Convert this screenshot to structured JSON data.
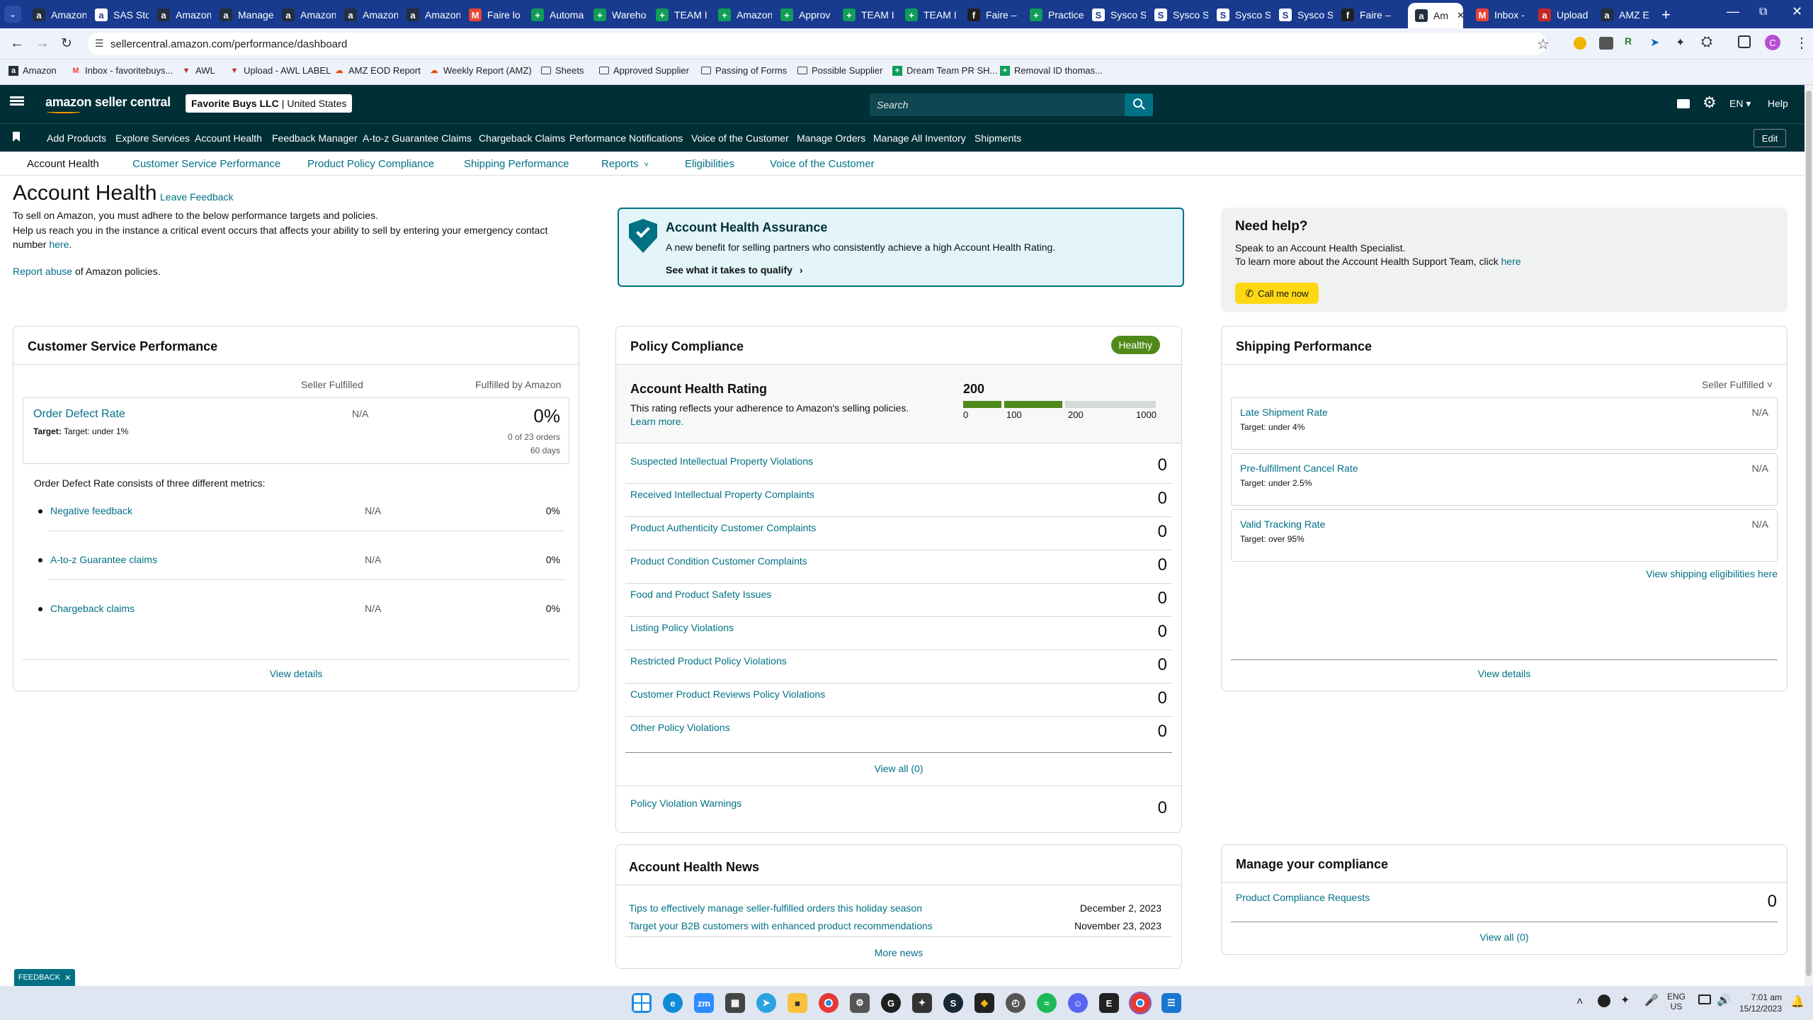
{
  "browser": {
    "tabs": [
      {
        "label": "Amazon",
        "icon": "amazon-favicon",
        "color": "#232f3e"
      },
      {
        "label": "SAS Sto",
        "icon": "sas-favicon",
        "color": "#ffffff"
      },
      {
        "label": "Amazon",
        "icon": "amazon-favicon",
        "color": "#232f3e"
      },
      {
        "label": "Manage",
        "icon": "amazon-favicon",
        "color": "#232f3e"
      },
      {
        "label": "Amazon",
        "icon": "amazon-favicon",
        "color": "#232f3e"
      },
      {
        "label": "Amazon",
        "icon": "amazon-favicon",
        "color": "#232f3e"
      },
      {
        "label": "Amazon",
        "icon": "amazon-favicon",
        "color": "#232f3e"
      },
      {
        "label": "Faire lo",
        "icon": "gmail-favicon",
        "color": "#ea4335"
      },
      {
        "label": "Automa",
        "icon": "sheets-favicon",
        "color": "#0f9d58"
      },
      {
        "label": "Wareho",
        "icon": "sheets-favicon",
        "color": "#0f9d58"
      },
      {
        "label": "TEAM I",
        "icon": "sheets-favicon",
        "color": "#0f9d58"
      },
      {
        "label": "Amazon",
        "icon": "sheets-favicon",
        "color": "#0f9d58"
      },
      {
        "label": "Approv",
        "icon": "sheets-favicon",
        "color": "#0f9d58"
      },
      {
        "label": "TEAM I",
        "icon": "sheets-favicon",
        "color": "#0f9d58"
      },
      {
        "label": "TEAM I",
        "icon": "sheets-favicon",
        "color": "#0f9d58"
      },
      {
        "label": "Faire –",
        "icon": "faire-favicon",
        "color": "#1f1f1f"
      },
      {
        "label": "Practice",
        "icon": "sheets-favicon",
        "color": "#0f9d58"
      },
      {
        "label": "Sysco S",
        "icon": "sysco-favicon",
        "color": "#ffffff"
      },
      {
        "label": "Sysco S",
        "icon": "sysco-favicon",
        "color": "#ffffff"
      },
      {
        "label": "Sysco S",
        "icon": "sysco-favicon",
        "color": "#ffffff"
      },
      {
        "label": "Sysco S",
        "icon": "sysco-favicon",
        "color": "#ffffff"
      },
      {
        "label": "Faire –",
        "icon": "faire-favicon",
        "color": "#1f1f1f"
      },
      {
        "label": "Am",
        "icon": "amazon-favicon",
        "color": "#232f3e",
        "active": true
      },
      {
        "label": "Inbox -",
        "icon": "gmail-favicon",
        "color": "#ea4335"
      },
      {
        "label": "Upload",
        "icon": "awl-favicon",
        "color": "#c62828"
      },
      {
        "label": "AMZ E",
        "icon": "amz-favicon",
        "color": "#232f3e"
      }
    ],
    "url": "sellercentral.amazon.com/performance/dashboard",
    "bookmarks": [
      {
        "label": "Amazon",
        "icon": "amazon-favicon"
      },
      {
        "label": "Inbox - favoritebuys...",
        "icon": "gmail-favicon"
      },
      {
        "label": "AWL",
        "icon": "awl-favicon"
      },
      {
        "label": "Upload - AWL LABEL",
        "icon": "awl-favicon"
      },
      {
        "label": "AMZ EOD Report",
        "icon": "report-favicon"
      },
      {
        "label": "Weekly Report (AMZ)",
        "icon": "report-favicon"
      },
      {
        "label": "Sheets",
        "icon": "folder-icon"
      },
      {
        "label": "Approved Supplier",
        "icon": "folder-icon"
      },
      {
        "label": "Passing of Forms",
        "icon": "folder-icon"
      },
      {
        "label": "Possible Supplier",
        "icon": "folder-icon"
      },
      {
        "label": "Dream Team PR SH...",
        "icon": "sheets-favicon"
      },
      {
        "label": "Removal ID thomas...",
        "icon": "sheets-favicon"
      }
    ]
  },
  "header": {
    "logo_text": "amazon seller central",
    "account": "Favorite Buys LLC",
    "marketplace": "United States",
    "search_placeholder": "Search",
    "language": "EN",
    "help": "Help",
    "edit": "Edit",
    "nav": [
      "Add Products",
      "Explore Services",
      "Account Health",
      "Feedback Manager",
      "A-to-z Guarantee Claims",
      "Chargeback Claims",
      "Performance Notifications",
      "Voice of the Customer",
      "Manage Orders",
      "Manage All Inventory",
      "Shipments"
    ],
    "subnav": [
      "Account Health",
      "Customer Service Performance",
      "Product Policy Compliance",
      "Shipping Performance",
      "Reports",
      "Eligibilities",
      "Voice of the Customer"
    ]
  },
  "intro": {
    "title": "Account Health",
    "leave_feedback": "Leave Feedback",
    "line1": "To sell on Amazon, you must adhere to the below performance targets and policies.",
    "line2": "Help us reach you in the instance a critical event occurs that affects your ability to sell by entering your emergency contact number",
    "here": "here",
    "report_abuse": "Report abuse",
    "report_suffix": "of Amazon policies."
  },
  "assurance": {
    "title": "Account Health Assurance",
    "desc": "A new benefit for selling partners who consistently achieve a high Account Health Rating.",
    "link": "See what it takes to qualify"
  },
  "help_box": {
    "title": "Need help?",
    "line1": "Speak to an Account Health Specialist.",
    "line2": "To learn more about the Account Health Support Team, click",
    "here": "here",
    "button": "Call me now"
  },
  "csp": {
    "title": "Customer Service Performance",
    "col1": "Seller Fulfilled",
    "col2": "Fulfilled by Amazon",
    "odr_label": "Order Defect Rate",
    "odr_target": "Target: under 1%",
    "odr_sf": "N/A",
    "odr_fba": "0%",
    "odr_orders": "0 of 23 orders",
    "odr_days": "60 days",
    "consists": "Order Defect Rate consists of three different metrics:",
    "metrics": [
      {
        "label": "Negative feedback",
        "sf": "N/A",
        "fba": "0%"
      },
      {
        "label": "A-to-z Guarantee claims",
        "sf": "N/A",
        "fba": "0%"
      },
      {
        "label": "Chargeback claims",
        "sf": "N/A",
        "fba": "0%"
      }
    ],
    "view_details": "View details"
  },
  "policy": {
    "title": "Policy Compliance",
    "badge": "Healthy",
    "ahr_title": "Account Health Rating",
    "ahr_desc": "This rating reflects your adherence to Amazon's selling policies.",
    "learn_more": "Learn more.",
    "rating": "200",
    "rating_value": 200,
    "scale": [
      "0",
      "100",
      "200",
      "1000"
    ],
    "items": [
      {
        "label": "Suspected Intellectual Property Violations",
        "count": "0"
      },
      {
        "label": "Received Intellectual Property Complaints",
        "count": "0"
      },
      {
        "label": "Product Authenticity Customer Complaints",
        "count": "0"
      },
      {
        "label": "Product Condition Customer Complaints",
        "count": "0"
      },
      {
        "label": "Food and Product Safety Issues",
        "count": "0"
      },
      {
        "label": "Listing Policy Violations",
        "count": "0"
      },
      {
        "label": "Restricted Product Policy Violations",
        "count": "0"
      },
      {
        "label": "Customer Product Reviews Policy Violations",
        "count": "0"
      },
      {
        "label": "Other Policy Violations",
        "count": "0"
      }
    ],
    "view_all": "View all (0)",
    "warnings_label": "Policy Violation Warnings",
    "warnings_count": "0"
  },
  "shipping": {
    "title": "Shipping Performance",
    "filter": "Seller Fulfilled",
    "items": [
      {
        "label": "Late Shipment Rate",
        "target": "Target: under 4%",
        "value": "N/A"
      },
      {
        "label": "Pre-fulfillment Cancel Rate",
        "target": "Target: under 2.5%",
        "value": "N/A"
      },
      {
        "label": "Valid Tracking Rate",
        "target": "Target: over 95%",
        "value": "N/A"
      }
    ],
    "eligibilities": "View shipping eligibilities here",
    "view_details": "View details"
  },
  "news": {
    "title": "Account Health News",
    "items": [
      {
        "label": "Tips to effectively manage seller-fulfilled orders this holiday season",
        "date": "December 2, 2023"
      },
      {
        "label": "Target your B2B customers with enhanced product recommendations",
        "date": "November 23, 2023"
      }
    ],
    "more": "More news"
  },
  "compliance": {
    "title": "Manage your compliance",
    "item": "Product Compliance Requests",
    "count": "0",
    "view_all": "View all (0)"
  },
  "feedback_tab": "FEEDBACK",
  "taskbar": {
    "lang1": "ENG",
    "lang2": "US",
    "time": "7:01 am",
    "date": "15/12/2023"
  },
  "colors": {
    "header": "#002f36",
    "link": "#007185",
    "healthy": "#508a1b",
    "assurance_bg": "#e3f5f8",
    "assurance_border": "#007185",
    "help_button": "#ffd814"
  }
}
